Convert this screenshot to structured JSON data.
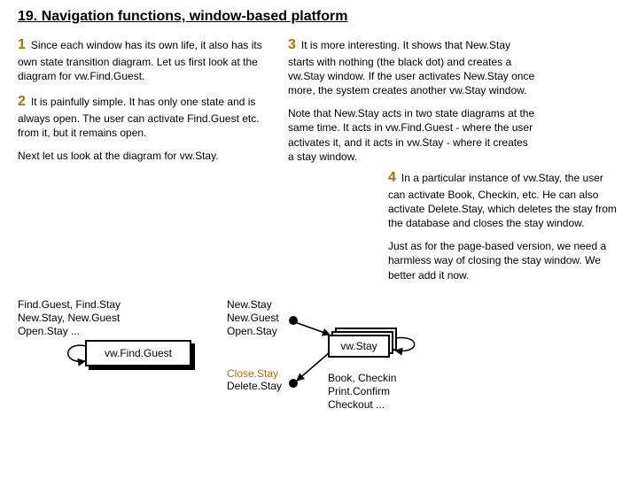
{
  "title": "19. Navigation functions, window-based platform",
  "p1_num": "1",
  "p1": "Since each window has its own life, it also has its own state transition diagram. Let us first look at the diagram for vw.Find.Guest.",
  "p2_num": "2",
  "p2": "It is painfully simple. It has only one state and is always open. The user can activate Find.Guest etc. from it, but it remains open.",
  "p2b": "Next let us look at the diagram for vw.Stay.",
  "p3_num": "3",
  "p3": "It is more interesting. It shows that New.Stay starts with nothing (the black dot) and creates a vw.Stay window. If the user activates New.Stay once more, the system creates another vw.Stay window.",
  "p3b": "Note that New.Stay acts in two state diagrams at the same time. It acts in vw.Find.Guest - where the user activates it, and it acts in vw.Stay - where it creates a stay window.",
  "p4_num": "4",
  "p4": "In a particular instance of vw.Stay, the user can activate Book, Checkin, etc. He can also activate Delete.Stay, which deletes the stay from the database and closes the stay window.",
  "p4b": "Just as for the page-based version, we need a harmless way of closing the stay window. We better add it now.",
  "diag": {
    "box1_label": "vw.Find.Guest",
    "box1_actions": "Find.Guest, Find.Stay\nNew.Stay, New.Guest\nOpen.Stay ...",
    "box2_label": "vw.Stay",
    "box2_in": "New.Stay\nNew.Guest\nOpen.Stay",
    "box2_close": "Close.Stay",
    "box2_delete": "Delete.Stay",
    "box2_self": "Book, Checkin\nPrint.Confirm\nCheckout ..."
  }
}
